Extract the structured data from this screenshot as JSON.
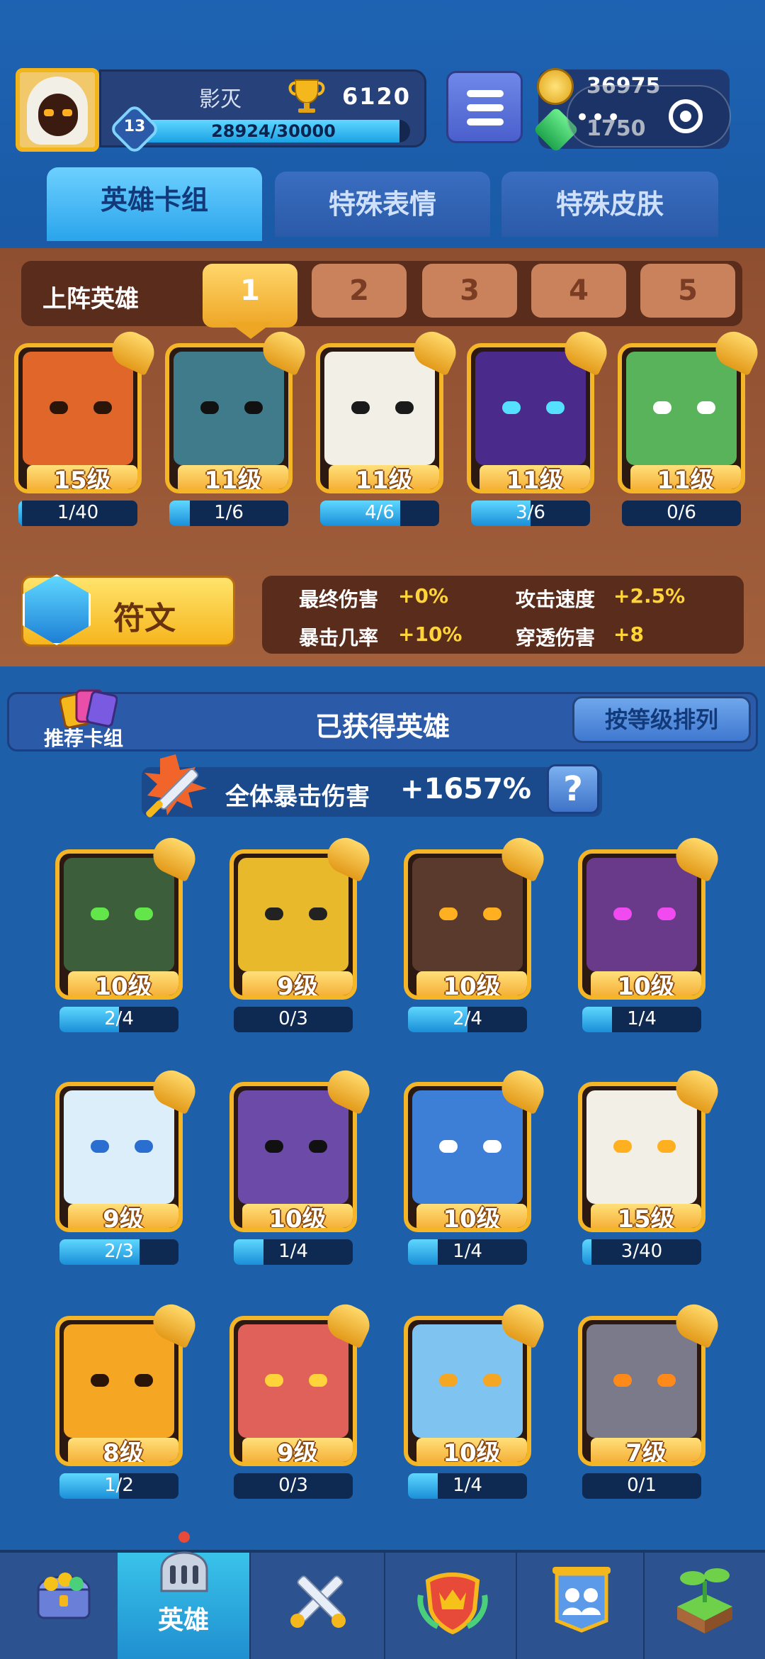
{
  "player": {
    "name": "影灭",
    "trophies": "6120",
    "level": "13",
    "xp_text": "28924/30000",
    "xp_fraction": 0.964
  },
  "currency": {
    "coins": "36975",
    "gems": "1750",
    "capsule_dots": "•••"
  },
  "tabs": [
    {
      "label": "英雄卡组",
      "active": true
    },
    {
      "label": "特殊表情",
      "active": false
    },
    {
      "label": "特殊皮肤",
      "active": false
    }
  ],
  "deck": {
    "label": "上阵英雄",
    "slots": [
      "1",
      "2",
      "3",
      "4",
      "5"
    ],
    "active_slot": "1",
    "heroes": [
      {
        "level": "15级",
        "progress": "1/40",
        "fill": 0.025,
        "color": "#e0662a",
        "eye": "#2b1408"
      },
      {
        "level": "11级",
        "progress": "1/6",
        "fill": 0.167,
        "color": "#3f7b8a",
        "eye": "#111111"
      },
      {
        "level": "11级",
        "progress": "4/6",
        "fill": 0.667,
        "color": "#f2efe6",
        "eye": "#1a1a1a"
      },
      {
        "level": "11级",
        "progress": "3/6",
        "fill": 0.5,
        "color": "#4a2a8a",
        "eye": "#55e0ff"
      },
      {
        "level": "11级",
        "progress": "0/6",
        "fill": 0.0,
        "color": "#58b35a",
        "eye": "#ffffff"
      }
    ]
  },
  "rune": {
    "label": "符文",
    "stats": [
      {
        "key": "最终伤害",
        "value": "+0%"
      },
      {
        "key": "攻击速度",
        "value": "+2.5%"
      },
      {
        "key": "暴击几率",
        "value": "+10%"
      },
      {
        "key": "穿透伤害",
        "value": "+8"
      }
    ]
  },
  "owned": {
    "recommend_label": "推荐卡组",
    "title": "已获得英雄",
    "sort_label": "按等级排列",
    "crit_label": "全体暴击伤害",
    "crit_value": "+1657%",
    "help_label": "?",
    "heroes": [
      {
        "level": "10级",
        "progress": "2/4",
        "fill": 0.5,
        "color": "#3d5e3a",
        "eye": "#63e64a"
      },
      {
        "level": "9级",
        "progress": "0/3",
        "fill": 0.0,
        "color": "#e8b92a",
        "eye": "#222222"
      },
      {
        "level": "10级",
        "progress": "2/4",
        "fill": 0.5,
        "color": "#5a3a2c",
        "eye": "#ffb020"
      },
      {
        "level": "10级",
        "progress": "1/4",
        "fill": 0.25,
        "color": "#6a3a8a",
        "eye": "#f04af0"
      },
      {
        "level": "9级",
        "progress": "2/3",
        "fill": 0.667,
        "color": "#dbeefa",
        "eye": "#2a6fd0"
      },
      {
        "level": "10级",
        "progress": "1/4",
        "fill": 0.25,
        "color": "#6b4aa8",
        "eye": "#111111"
      },
      {
        "level": "10级",
        "progress": "1/4",
        "fill": 0.25,
        "color": "#3d7fd6",
        "eye": "#ffffff"
      },
      {
        "level": "15级",
        "progress": "3/40",
        "fill": 0.075,
        "color": "#f2efe6",
        "eye": "#ffb020"
      },
      {
        "level": "8级",
        "progress": "1/2",
        "fill": 0.5,
        "color": "#f5a623",
        "eye": "#2b1408"
      },
      {
        "level": "9级",
        "progress": "0/3",
        "fill": 0.0,
        "color": "#e0605a",
        "eye": "#ffd43b"
      },
      {
        "level": "10级",
        "progress": "1/4",
        "fill": 0.25,
        "color": "#7fc4f0",
        "eye": "#f5a623"
      },
      {
        "level": "7级",
        "progress": "0/1",
        "fill": 0.0,
        "color": "#7a7a8a",
        "eye": "#ff8a1a"
      }
    ]
  },
  "bottom_nav": [
    {
      "name": "treasure-chest",
      "label": "",
      "active": false
    },
    {
      "name": "heroes",
      "label": "英雄",
      "active": true
    },
    {
      "name": "battle",
      "label": "",
      "active": false
    },
    {
      "name": "shield-crown",
      "label": "",
      "active": false
    },
    {
      "name": "social",
      "label": "",
      "active": false
    },
    {
      "name": "sprout",
      "label": "",
      "active": false
    }
  ]
}
